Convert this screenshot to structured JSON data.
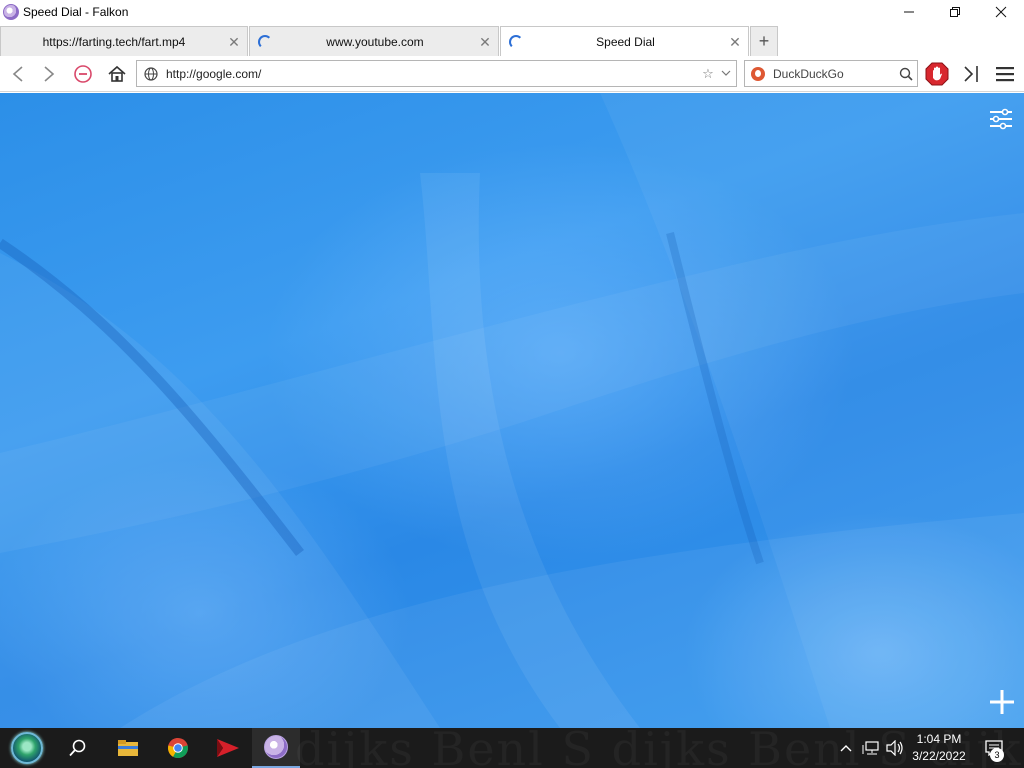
{
  "window": {
    "title": "Speed Dial - Falkon",
    "app_icon": "falkon-icon",
    "controls": [
      "minimize",
      "restore",
      "close"
    ]
  },
  "tabs": [
    {
      "label": "https://farting.tech/fart.mp4",
      "loading": false,
      "active": false
    },
    {
      "label": "www.youtube.com",
      "loading": true,
      "active": false
    },
    {
      "label": "Speed Dial",
      "loading": true,
      "active": true
    }
  ],
  "navbar": {
    "url": "http://google.com/",
    "search_engine": "DuckDuckGo",
    "icons": [
      "back-icon",
      "forward-icon",
      "stop-icon",
      "home-icon",
      "globe-icon",
      "star-icon",
      "dropdown-icon",
      "search-icon",
      "adblock-icon",
      "sidebar-icon",
      "menu-icon"
    ]
  },
  "content": {
    "background_color": "#2c8fe8",
    "icons": [
      "settings-icon",
      "add-icon"
    ]
  },
  "taskbar": {
    "time": "1:04 PM",
    "date": "3/22/2022",
    "notification_count": "3",
    "watermark_text": "dijks  Benl S  dijks  Benl S  dijks",
    "apps": [
      "start-orb-icon",
      "search-icon",
      "file-explorer-icon",
      "chrome-icon",
      "app-arrow-icon",
      "falkon-icon"
    ]
  }
}
